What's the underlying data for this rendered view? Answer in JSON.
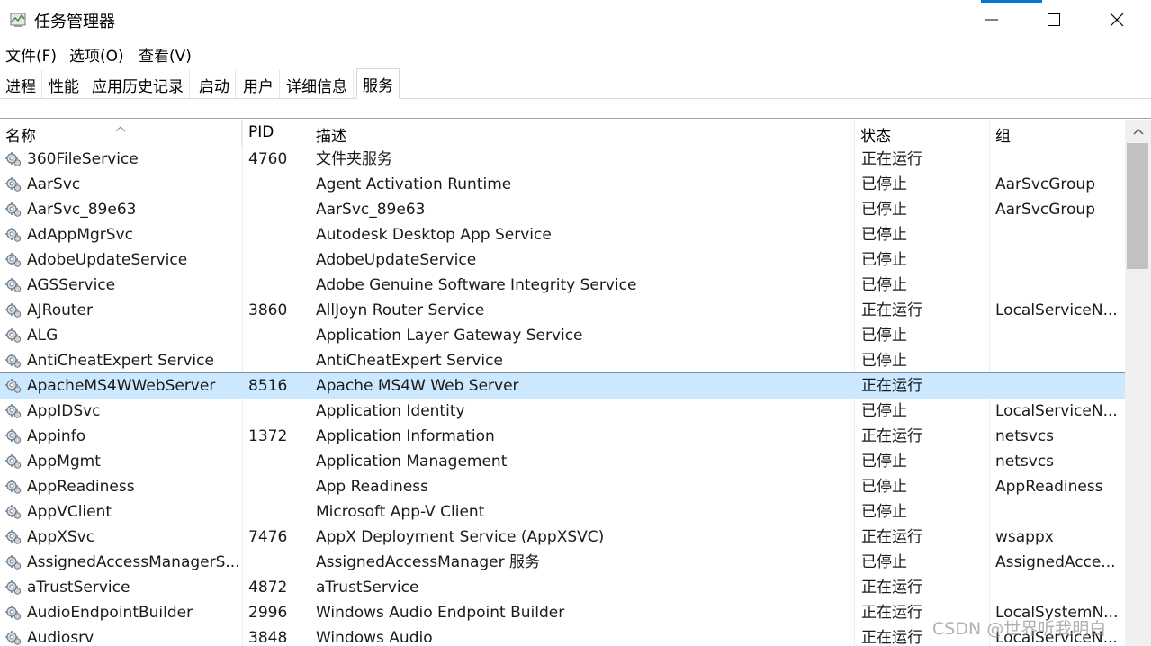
{
  "window": {
    "title": "任务管理器",
    "app_icon": "task-manager-icon",
    "accent_color": "#0078d7",
    "controls": [
      "minimize-icon",
      "maximize-icon",
      "close-icon"
    ]
  },
  "menu": [
    "文件(F)",
    "选项(O)",
    "查看(V)"
  ],
  "tabs": [
    {
      "label": "进程",
      "active": false
    },
    {
      "label": "性能",
      "active": false
    },
    {
      "label": "应用历史记录",
      "active": false
    },
    {
      "label": "启动",
      "active": false
    },
    {
      "label": "用户",
      "active": false
    },
    {
      "label": "详细信息",
      "active": false
    },
    {
      "label": "服务",
      "active": true
    }
  ],
  "table": {
    "columns": [
      "名称",
      "PID",
      "描述",
      "状态",
      "组"
    ],
    "sorted_column": "名称",
    "selected_color": "#cce8ff",
    "rows": [
      [
        "360FileService",
        "4760",
        "文件夹服务",
        "正在运行",
        ""
      ],
      [
        "AarSvc",
        "",
        "Agent Activation Runtime",
        "已停止",
        "AarSvcGroup"
      ],
      [
        "AarSvc_89e63",
        "",
        "AarSvc_89e63",
        "已停止",
        "AarSvcGroup"
      ],
      [
        "AdAppMgrSvc",
        "",
        "Autodesk Desktop App Service",
        "已停止",
        ""
      ],
      [
        "AdobeUpdateService",
        "",
        "AdobeUpdateService",
        "已停止",
        ""
      ],
      [
        "AGSService",
        "",
        "Adobe Genuine Software Integrity Service",
        "已停止",
        ""
      ],
      [
        "AJRouter",
        "3860",
        "AllJoyn Router Service",
        "正在运行",
        "LocalServiceN..."
      ],
      [
        "ALG",
        "",
        "Application Layer Gateway Service",
        "已停止",
        ""
      ],
      [
        "AntiCheatExpert Service",
        "",
        "AntiCheatExpert Service",
        "已停止",
        ""
      ],
      [
        "ApacheMS4WWebServer",
        "8516",
        "Apache MS4W Web Server",
        "正在运行",
        ""
      ],
      [
        "AppIDSvc",
        "",
        "Application Identity",
        "已停止",
        "LocalServiceN..."
      ],
      [
        "Appinfo",
        "1372",
        "Application Information",
        "正在运行",
        "netsvcs"
      ],
      [
        "AppMgmt",
        "",
        "Application Management",
        "已停止",
        "netsvcs"
      ],
      [
        "AppReadiness",
        "",
        "App Readiness",
        "已停止",
        "AppReadiness"
      ],
      [
        "AppVClient",
        "",
        "Microsoft App-V Client",
        "已停止",
        ""
      ],
      [
        "AppXSvc",
        "7476",
        "AppX Deployment Service (AppXSVC)",
        "正在运行",
        "wsappx"
      ],
      [
        "AssignedAccessManagerS...",
        "",
        "AssignedAccessManager 服务",
        "已停止",
        "AssignedAcce..."
      ],
      [
        "aTrustService",
        "4872",
        "aTrustService",
        "正在运行",
        ""
      ],
      [
        "AudioEndpointBuilder",
        "2996",
        "Windows Audio Endpoint Builder",
        "正在运行",
        "LocalSystemN..."
      ],
      [
        "Audiosrv",
        "3848",
        "Windows Audio",
        "正在运行",
        "LocalServiceN..."
      ]
    ],
    "selected_row": 9,
    "row_icon": "service-gear-icon"
  },
  "scrollbar": {
    "up_icon": "scroll-up-arrow-icon"
  },
  "watermark": "CSDN @世界听我明白"
}
